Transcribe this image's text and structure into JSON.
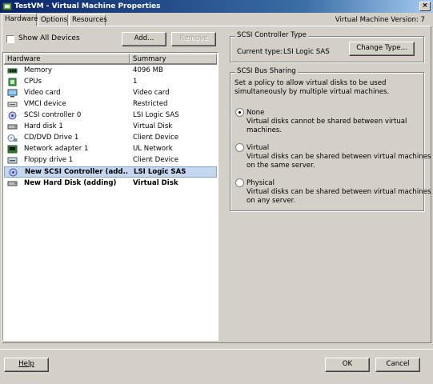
{
  "window": {
    "title": "TestVM - Virtual Machine Properties",
    "version_text": "Virtual Machine Version: 7"
  },
  "tabs": [
    "Hardware",
    "Options",
    "Resources"
  ],
  "hardware_panel": {
    "show_all_devices_label": "Show All Devices",
    "show_all_devices_checked": false,
    "add_button": "Add...",
    "remove_button": "Remove",
    "columns": [
      "Hardware",
      "Summary"
    ],
    "rows": [
      {
        "icon": "memory-icon",
        "name": "Memory",
        "summary": "4096 MB"
      },
      {
        "icon": "cpu-icon",
        "name": "CPUs",
        "summary": "1"
      },
      {
        "icon": "video-card-icon",
        "name": "Video card",
        "summary": "Video card"
      },
      {
        "icon": "vmci-device-icon",
        "name": "VMCI device",
        "summary": "Restricted"
      },
      {
        "icon": "scsi-controller-icon",
        "name": "SCSI controller 0",
        "summary": "LSI Logic SAS"
      },
      {
        "icon": "hard-disk-icon",
        "name": "Hard disk 1",
        "summary": "Virtual Disk"
      },
      {
        "icon": "cd-dvd-drive-icon",
        "name": "CD/DVD Drive 1",
        "summary": "Client Device"
      },
      {
        "icon": "network-adapter-icon",
        "name": "Network adapter 1",
        "summary": "UL Network"
      },
      {
        "icon": "floppy-drive-icon",
        "name": "Floppy drive 1",
        "summary": "Client Device"
      },
      {
        "icon": "scsi-controller-icon",
        "name": "New SCSI Controller (add...",
        "summary": "LSI Logic SAS"
      },
      {
        "icon": "hard-disk-icon",
        "name": "New Hard Disk (adding)",
        "summary": "Virtual Disk"
      }
    ]
  },
  "scsi_controller_type": {
    "title": "SCSI Controller Type",
    "current_label": "Current type:",
    "current_value": "LSI Logic SAS",
    "change_button": "Change Type..."
  },
  "scsi_bus_sharing": {
    "title": "SCSI Bus Sharing",
    "description_line1": "Set a policy to allow virtual disks to be used",
    "description_line2": "simultaneously by multiple virtual machines.",
    "selected": "None",
    "options": [
      {
        "label": "None",
        "desc1": "Virtual disks cannot be shared between virtual",
        "desc2": "machines."
      },
      {
        "label": "Virtual",
        "desc1": "Virtual disks can be shared between virtual machines",
        "desc2": "on the same server."
      },
      {
        "label": "Physical",
        "desc1": "Virtual disks can be shared between virtual machines",
        "desc2": "on any server."
      }
    ]
  },
  "footer": {
    "help_button": "Help",
    "ok_button": "OK",
    "cancel_button": "Cancel"
  },
  "colors": {
    "titlebar_start": "#0a246a",
    "selection": "#c5d6ef",
    "face": "#d4d0c8"
  }
}
